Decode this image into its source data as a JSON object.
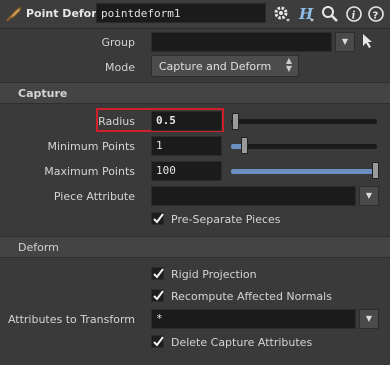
{
  "header": {
    "node_type": "Point Deform",
    "node_name": "pointdeform1",
    "icons": [
      "gear-icon",
      "help-h-icon",
      "search-icon",
      "info-icon",
      "question-icon"
    ]
  },
  "params": {
    "group": {
      "label": "Group",
      "value": ""
    },
    "mode": {
      "label": "Mode",
      "value": "Capture and Deform"
    }
  },
  "capture": {
    "title": "Capture",
    "radius": {
      "label": "Radius",
      "value": "0.5",
      "slider_fraction": 0.03
    },
    "min_points": {
      "label": "Minimum Points",
      "value": "1",
      "slider_fraction": 0.08
    },
    "max_points": {
      "label": "Maximum Points",
      "value": "100",
      "slider_fraction": 1.0
    },
    "piece_attribute": {
      "label": "Piece Attribute",
      "value": ""
    },
    "pre_separate": {
      "label": "Pre-Separate Pieces",
      "checked": true
    }
  },
  "deform": {
    "title": "Deform",
    "rigid_projection": {
      "label": "Rigid Projection",
      "checked": true
    },
    "recompute_normals": {
      "label": "Recompute Affected Normals",
      "checked": true
    },
    "attributes_to_transform": {
      "label": "Attributes to Transform",
      "value": "*"
    },
    "delete_capture": {
      "label": "Delete Capture Attributes",
      "checked": true
    }
  },
  "colors": {
    "highlight": "#d0202a",
    "slider_fill": "#6b8fc0"
  }
}
